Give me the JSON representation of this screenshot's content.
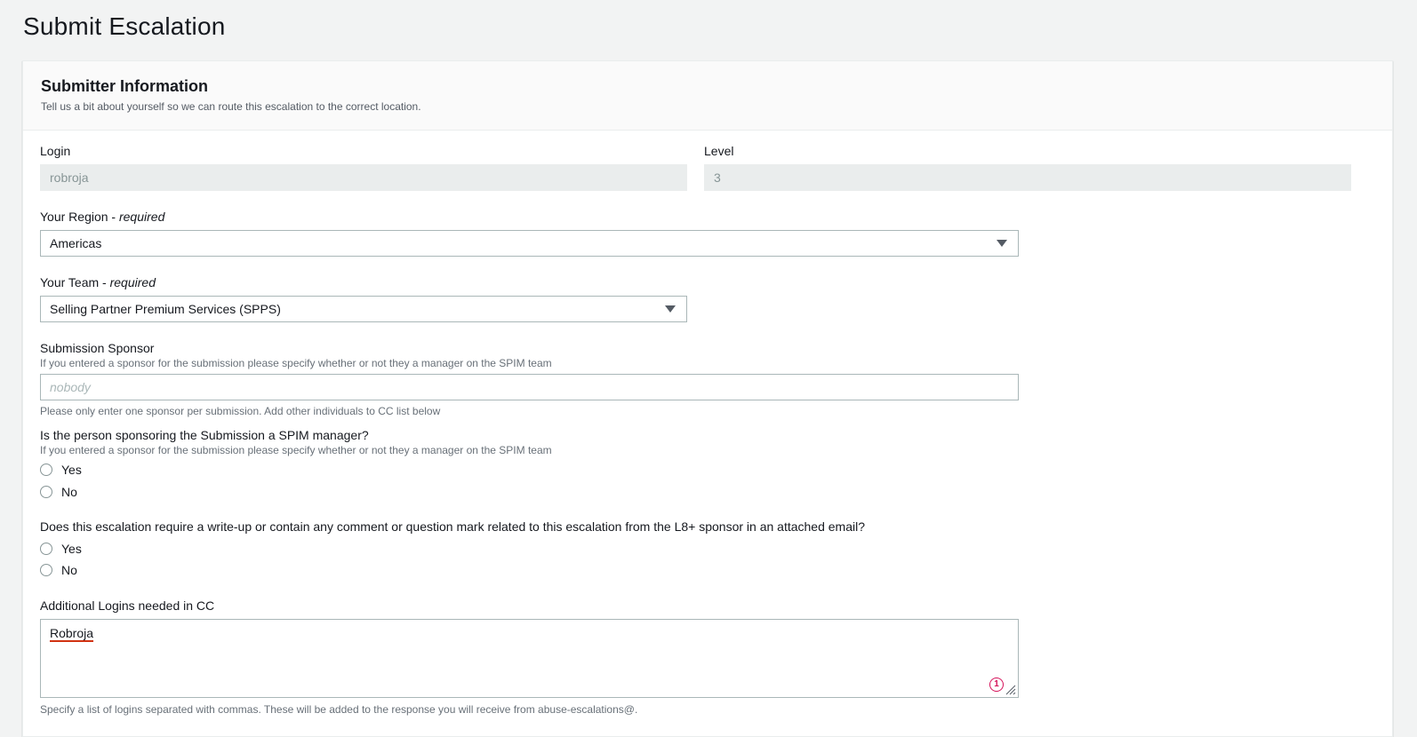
{
  "page": {
    "title": "Submit Escalation"
  },
  "section": {
    "title": "Submitter Information",
    "description": "Tell us a bit about yourself so we can route this escalation to the correct location."
  },
  "fields": {
    "login": {
      "label": "Login",
      "value": "robroja"
    },
    "level": {
      "label": "Level",
      "value": "3"
    },
    "region": {
      "label": "Your Region - ",
      "required": "required",
      "value": "Americas"
    },
    "team": {
      "label": "Your Team - ",
      "required": "required",
      "value": "Selling Partner Premium Services (SPPS)"
    },
    "sponsor": {
      "label": "Submission Sponsor",
      "hint": "If you entered a sponsor for the submission please specify whether or not they a manager on the SPIM team",
      "placeholder": "nobody",
      "footer": "Please only enter one sponsor per submission. Add other individuals to CC list below"
    },
    "spim_manager": {
      "label": "Is the person sponsoring the Submission a SPIM manager?",
      "hint": "If you entered a sponsor for the submission please specify whether or not they a manager on the SPIM team",
      "options": [
        "Yes",
        "No"
      ]
    },
    "writeup": {
      "label": "Does this escalation require a write-up or contain any comment or question mark related to this escalation from the L8+ sponsor in an attached email?",
      "options": [
        "Yes",
        "No"
      ]
    },
    "cc": {
      "label": "Additional Logins needed in CC",
      "value": "Robroja",
      "badge": "1",
      "footer": "Specify a list of logins separated with commas. These will be added to the response you will receive from abuse-escalations@."
    }
  },
  "colors": {
    "accent": "#d5135a",
    "spellcheck": "#d13212",
    "border": "#aab7b8"
  }
}
